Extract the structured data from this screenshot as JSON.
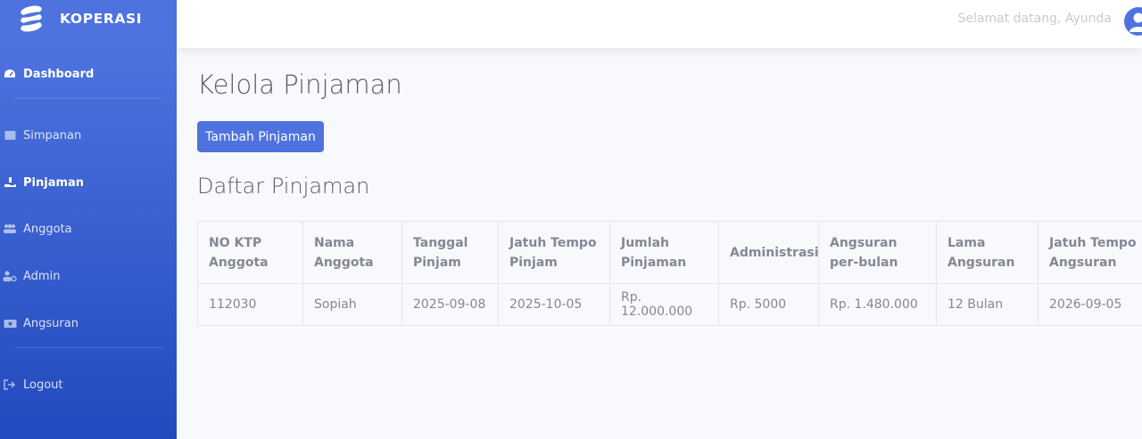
{
  "brand": {
    "name": "KOPERASI"
  },
  "sidebar": {
    "items": [
      {
        "label": "Dashboard",
        "icon": "tachometer-icon",
        "active": true
      },
      {
        "label": "Simpanan",
        "icon": "box-icon",
        "active": false
      },
      {
        "label": "Pinjaman",
        "icon": "hand-holding-icon",
        "active": true
      },
      {
        "label": "Anggota",
        "icon": "users-icon",
        "active": false
      },
      {
        "label": "Admin",
        "icon": "user-cog-icon",
        "active": false
      },
      {
        "label": "Angsuran",
        "icon": "money-bill-icon",
        "active": false
      },
      {
        "label": "Logout",
        "icon": "sign-out-icon",
        "active": false
      }
    ]
  },
  "topbar": {
    "welcome": "Selamat datang, Ayunda"
  },
  "main": {
    "title": "Kelola Pinjaman",
    "add_button": "Tambah Pinjaman",
    "section_title": "Daftar Pinjaman"
  },
  "table": {
    "headers": [
      "NO KTP Anggota",
      "Nama Anggota",
      "Tanggal Pinjam",
      "Jatuh Tempo Pinjam",
      "Jumlah Pinjaman",
      "Administrasi",
      "Angsuran per-bulan",
      "Lama Angsuran",
      "Jatuh Tempo Angsuran"
    ],
    "rows": [
      [
        "112030",
        "Sopiah",
        "2025-09-08",
        "2025-10-05",
        "Rp. 12.000.000",
        "Rp. 5000",
        "Rp. 1.480.000",
        "12 Bulan",
        "2026-09-05"
      ]
    ]
  },
  "colors": {
    "primary": "#4e73df",
    "sidebar_end": "#224abe",
    "text_muted": "#858796",
    "title": "#5a5c69"
  }
}
